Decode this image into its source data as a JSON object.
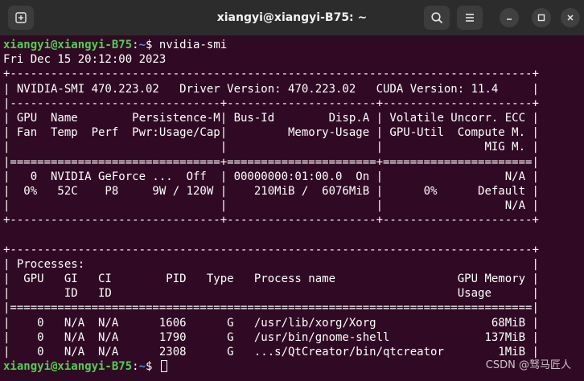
{
  "window": {
    "title": "xiangyi@xiangyi-B75: ~"
  },
  "titlebar": {
    "new_tab_icon": "new-tab-icon",
    "search_icon": "search-icon",
    "menu_icon": "hamburger-menu-icon",
    "minimize_icon": "minimize-icon",
    "maximize_icon": "maximize-icon",
    "close_icon": "close-icon"
  },
  "prompt": {
    "user": "xiangyi@xiangyi-B75",
    "separator": ":",
    "path": "~",
    "symbol": "$ "
  },
  "command": "nvidia-smi",
  "output": [
    "Fri Dec 15 20:12:00 2023",
    "+-----------------------------------------------------------------------------+",
    "| NVIDIA-SMI 470.223.02   Driver Version: 470.223.02   CUDA Version: 11.4     |",
    "|-------------------------------+----------------------+----------------------+",
    "| GPU  Name        Persistence-M| Bus-Id        Disp.A | Volatile Uncorr. ECC |",
    "| Fan  Temp  Perf  Pwr:Usage/Cap|         Memory-Usage | GPU-Util  Compute M. |",
    "|                               |                      |               MIG M. |",
    "|===============================+======================+======================|",
    "|   0  NVIDIA GeForce ...  Off  | 00000000:01:00.0  On |                  N/A |",
    "|  0%   52C    P8     9W / 120W |    210MiB /  6076MiB |      0%      Default |",
    "|                               |                      |                  N/A |",
    "+-------------------------------+----------------------+----------------------+",
    "",
    "+-----------------------------------------------------------------------------+",
    "| Processes:                                                                  |",
    "|  GPU   GI   CI        PID   Type   Process name                  GPU Memory |",
    "|        ID   ID                                                   Usage      |",
    "|=============================================================================|",
    "|    0   N/A  N/A      1606      G   /usr/lib/xorg/Xorg                 68MiB |",
    "|    0   N/A  N/A      1790      G   /usr/bin/gnome-shell              137MiB |",
    "|    0   N/A  N/A      2308      G   ...s/QtCreator/bin/qtcreator        1MiB |"
  ],
  "watermark": "CSDN @驽马匠人"
}
